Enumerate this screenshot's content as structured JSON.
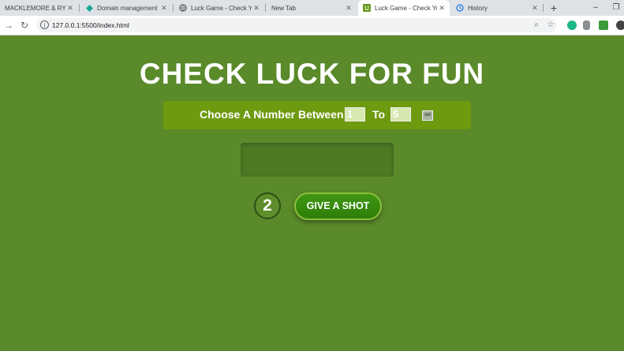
{
  "browser": {
    "tabs": [
      {
        "title": "MACKLEMORE & RYAN",
        "favicon": "youtube-icon",
        "active": false
      },
      {
        "title": "Domain management |",
        "favicon": "diamond-icon",
        "active": false
      },
      {
        "title": "Luck Game - Check You",
        "favicon": "globe-icon",
        "active": false
      },
      {
        "title": "New Tab",
        "favicon": "",
        "active": false
      },
      {
        "title": "Luck Game - Check You",
        "favicon": "smiley-icon",
        "active": true
      },
      {
        "title": "History",
        "favicon": "history-icon",
        "active": false
      }
    ],
    "url": "127.0.0.1:5500/index.html",
    "new_tab_glyph": "+",
    "minimize_glyph": "–",
    "restore_glyph": "❐",
    "back_glyph": "→",
    "reload_glyph": "↻",
    "info_glyph": "i",
    "zoom_glyph": "⌕",
    "star_glyph": "☆",
    "close_glyph": "✕"
  },
  "page": {
    "headline": "CHECK LUCK FOR FUN",
    "range_label": "Choose A Number Between",
    "range_min": "1",
    "range_to": "To",
    "range_max": "5",
    "set_label": "set",
    "guess_value": "",
    "tries_left": "2",
    "shot_button": "GIVE A SHOT"
  },
  "colors": {
    "background": "#5a8a2a",
    "range_bar": "#6e9a10",
    "button": "#3a9010"
  }
}
